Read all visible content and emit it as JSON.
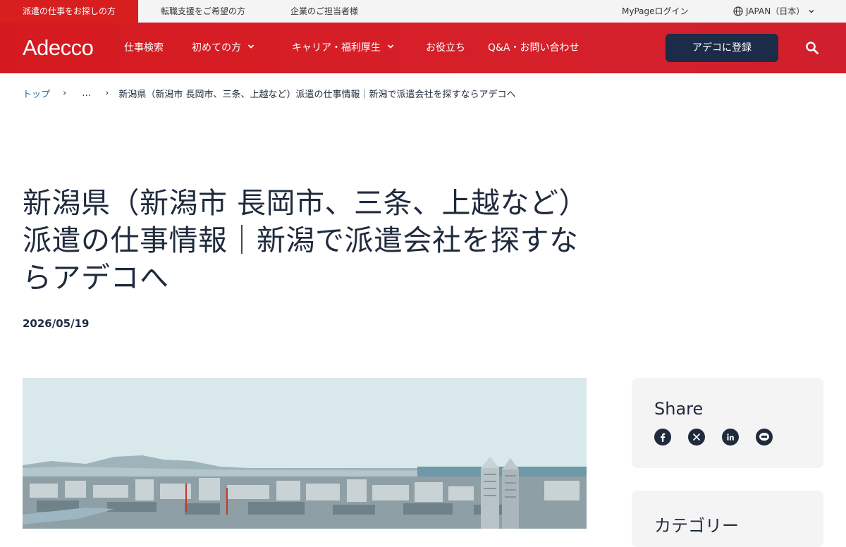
{
  "util_bar": {
    "tabs": [
      "派遣の仕事をお探しの方",
      "転職支援をご希望の方",
      "企業のご担当者様"
    ],
    "login": "MyPageログイン",
    "language": "JAPAN（日本）"
  },
  "nav": {
    "logo": "Adecco",
    "items": [
      "仕事検索",
      "初めての方",
      "キャリア・福利厚生",
      "お役立ち",
      "Q&A・お問い合わせ"
    ],
    "register": "アデコに登録"
  },
  "breadcrumb": {
    "home": "トップ",
    "ellipsis": "…",
    "current": "新潟県（新潟市 長岡市、三条、上越など）派遣の仕事情報｜新潟で派遣会社を探すならアデコへ"
  },
  "article": {
    "title": "新潟県（新潟市 長岡市、三条、上越など）派遣の仕事情報｜新潟で派遣会社を探すならアデコへ",
    "date": "2026/05/19"
  },
  "sidebar": {
    "share_title": "Share",
    "share_icons": [
      "facebook-icon",
      "x-icon",
      "linkedin-icon",
      "line-icon"
    ],
    "category_title": "カテゴリー"
  },
  "colors": {
    "brand_red": "#d81f1f",
    "navy": "#1b2b48",
    "text": "#1f2b3d",
    "link": "#1a6fa8"
  }
}
